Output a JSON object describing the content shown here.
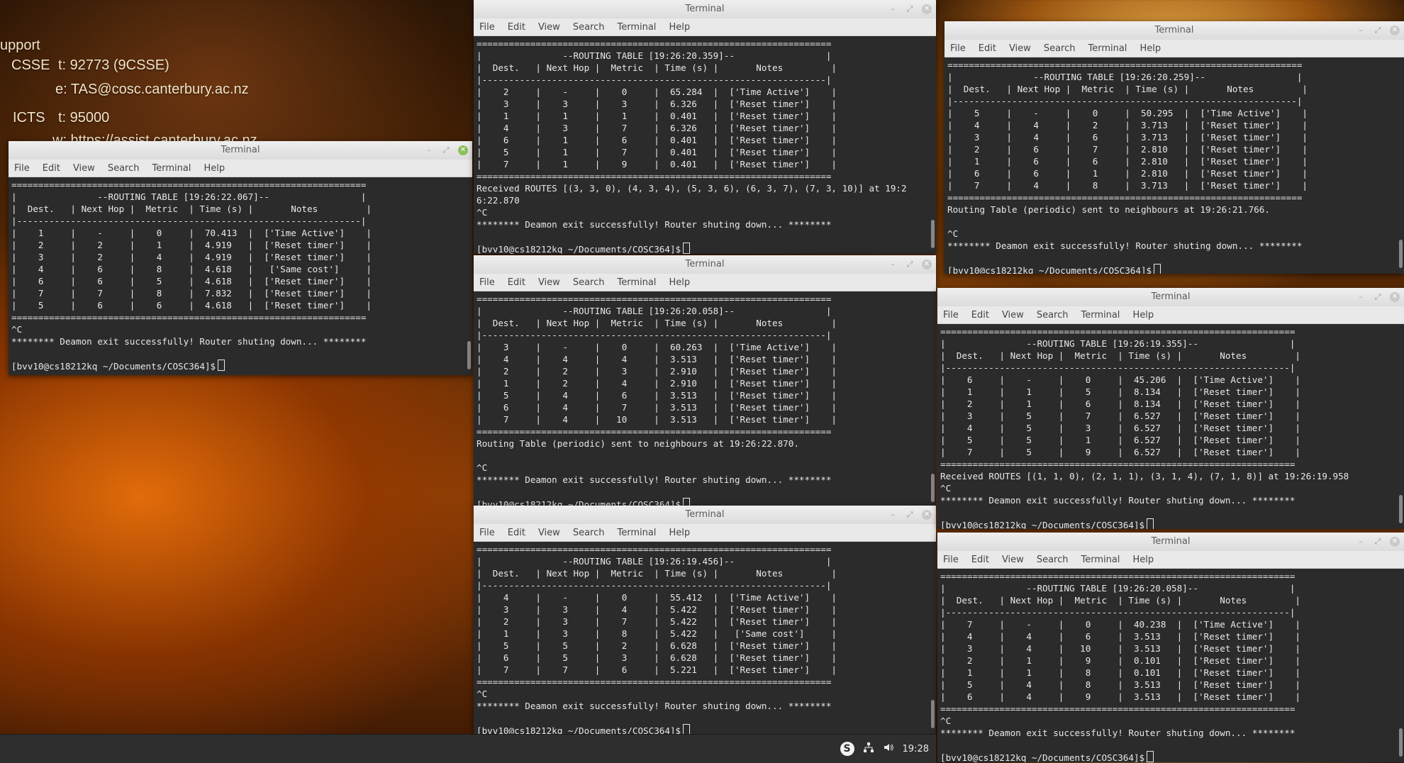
{
  "desktop": {
    "support_lines": [
      "upport",
      "CSSE",
      "t: 92773 (9CSSE)",
      "e: TAS@cosc.canterbury.ac.nz",
      "ICTS",
      "t: 95000",
      "w: https://assist.canterbury.ac.nz"
    ]
  },
  "menu": [
    "File",
    "Edit",
    "View",
    "Search",
    "Terminal",
    "Help"
  ],
  "windows": [
    {
      "title": "Terminal",
      "lines": [
        "==================================================================",
        "|               --ROUTING TABLE [19:26:22.067]--                 |",
        "|  Dest.   | Next Hop |  Metric  | Time (s) |       Notes         |",
        "|----------------------------------------------------------------|",
        "|    1     |    -     |    0     |  70.413  |  ['Time Active']    |",
        "|    2     |    2     |    1     |  4.919   |  ['Reset timer']    |",
        "|    3     |    2     |    4     |  4.919   |  ['Reset timer']    |",
        "|    4     |    6     |    8     |  4.618   |   ['Same cost']     |",
        "|    6     |    6     |    5     |  4.618   |  ['Reset timer']    |",
        "|    7     |    7     |    8     |  7.832   |  ['Reset timer']    |",
        "|    5     |    6     |    6     |  4.618   |  ['Reset timer']    |",
        "==================================================================",
        "^C",
        "******** Deamon exit successfully! Router shuting down... ********",
        "",
        "[bvv10@cs18212kq ~/Documents/COSC364]$"
      ]
    },
    {
      "title": "Terminal",
      "lines": [
        "==================================================================",
        "|               --ROUTING TABLE [19:26:20.359]--                 |",
        "|  Dest.   | Next Hop |  Metric  | Time (s) |       Notes         |",
        "|----------------------------------------------------------------|",
        "|    2     |    -     |    0     |  65.284  |  ['Time Active']    |",
        "|    3     |    3     |    3     |  6.326   |  ['Reset timer']    |",
        "|    1     |    1     |    1     |  0.401   |  ['Reset timer']    |",
        "|    4     |    3     |    7     |  6.326   |  ['Reset timer']    |",
        "|    6     |    1     |    6     |  0.401   |  ['Reset timer']    |",
        "|    5     |    1     |    7     |  0.401   |  ['Reset timer']    |",
        "|    7     |    1     |    9     |  0.401   |  ['Reset timer']    |",
        "==================================================================",
        "Received ROUTES [(3, 3, 0), (4, 3, 4), (5, 3, 6), (6, 3, 7), (7, 3, 10)] at 19:2",
        "6:22.870",
        "^C",
        "******** Deamon exit successfully! Router shuting down... ********",
        "",
        "[bvv10@cs18212kq ~/Documents/COSC364]$"
      ]
    },
    {
      "title": "Terminal",
      "lines": [
        "==================================================================",
        "|               --ROUTING TABLE [19:26:20.058]--                 |",
        "|  Dest.   | Next Hop |  Metric  | Time (s) |       Notes         |",
        "|----------------------------------------------------------------|",
        "|    3     |    -     |    0     |  60.263  |  ['Time Active']    |",
        "|    4     |    4     |    4     |  3.513   |  ['Reset timer']    |",
        "|    2     |    2     |    3     |  2.910   |  ['Reset timer']    |",
        "|    1     |    2     |    4     |  2.910   |  ['Reset timer']    |",
        "|    5     |    4     |    6     |  3.513   |  ['Reset timer']    |",
        "|    6     |    4     |    7     |  3.513   |  ['Reset timer']    |",
        "|    7     |    4     |   10     |  3.513   |  ['Reset timer']    |",
        "==================================================================",
        "Routing Table (periodic) sent to neighbours at 19:26:22.870.",
        "",
        "^C",
        "******** Deamon exit successfully! Router shuting down... ********",
        "",
        "[bvv10@cs18212kq ~/Documents/COSC364]$"
      ]
    },
    {
      "title": "Terminal",
      "lines": [
        "==================================================================",
        "|               --ROUTING TABLE [19:26:19.456]--                 |",
        "|  Dest.   | Next Hop |  Metric  | Time (s) |       Notes         |",
        "|----------------------------------------------------------------|",
        "|    4     |    -     |    0     |  55.412  |  ['Time Active']    |",
        "|    3     |    3     |    4     |  5.422   |  ['Reset timer']    |",
        "|    2     |    3     |    7     |  5.422   |  ['Reset timer']    |",
        "|    1     |    3     |    8     |  5.422   |   ['Same cost']     |",
        "|    5     |    5     |    2     |  6.628   |  ['Reset timer']    |",
        "|    6     |    5     |    3     |  6.628   |  ['Reset timer']    |",
        "|    7     |    7     |    6     |  5.221   |  ['Reset timer']    |",
        "==================================================================",
        "^C",
        "******** Deamon exit successfully! Router shuting down... ********",
        "",
        "[bvv10@cs18212kq ~/Documents/COSC364]$"
      ]
    },
    {
      "title": "Terminal",
      "lines": [
        "==================================================================",
        "|               --ROUTING TABLE [19:26:20.259]--                 |",
        "|  Dest.   | Next Hop |  Metric  | Time (s) |       Notes         |",
        "|----------------------------------------------------------------|",
        "|    5     |    -     |    0     |  50.295  |  ['Time Active']    |",
        "|    4     |    4     |    2     |  3.713   |  ['Reset timer']    |",
        "|    3     |    4     |    6     |  3.713   |  ['Reset timer']    |",
        "|    2     |    6     |    7     |  2.810   |  ['Reset timer']    |",
        "|    1     |    6     |    6     |  2.810   |  ['Reset timer']    |",
        "|    6     |    6     |    1     |  2.810   |  ['Reset timer']    |",
        "|    7     |    4     |    8     |  3.713   |  ['Reset timer']    |",
        "==================================================================",
        "Routing Table (periodic) sent to neighbours at 19:26:21.766.",
        "",
        "^C",
        "******** Deamon exit successfully! Router shuting down... ********",
        "",
        "[bvv10@cs18212kq ~/Documents/COSC364]$"
      ]
    },
    {
      "title": "Terminal",
      "lines": [
        "==================================================================",
        "|               --ROUTING TABLE [19:26:19.355]--                 |",
        "|  Dest.   | Next Hop |  Metric  | Time (s) |       Notes         |",
        "|----------------------------------------------------------------|",
        "|    6     |    -     |    0     |  45.206  |  ['Time Active']    |",
        "|    1     |    1     |    5     |  8.134   |  ['Reset timer']    |",
        "|    2     |    1     |    6     |  8.134   |  ['Reset timer']    |",
        "|    3     |    5     |    7     |  6.527   |  ['Reset timer']    |",
        "|    4     |    5     |    3     |  6.527   |  ['Reset timer']    |",
        "|    5     |    5     |    1     |  6.527   |  ['Reset timer']    |",
        "|    7     |    5     |    9     |  6.527   |  ['Reset timer']    |",
        "==================================================================",
        "Received ROUTES [(1, 1, 0), (2, 1, 1), (3, 1, 4), (7, 1, 8)] at 19:26:19.958",
        "^C",
        "******** Deamon exit successfully! Router shuting down... ********",
        "",
        "[bvv10@cs18212kq ~/Documents/COSC364]$"
      ]
    },
    {
      "title": "Terminal",
      "lines": [
        "==================================================================",
        "|               --ROUTING TABLE [19:26:20.058]--                 |",
        "|  Dest.   | Next Hop |  Metric  | Time (s) |       Notes         |",
        "|----------------------------------------------------------------|",
        "|    7     |    -     |    0     |  40.238  |  ['Time Active']    |",
        "|    4     |    4     |    6     |  3.513   |  ['Reset timer']    |",
        "|    3     |    4     |   10     |  3.513   |  ['Reset timer']    |",
        "|    2     |    1     |    9     |  0.101   |  ['Reset timer']    |",
        "|    1     |    1     |    8     |  0.101   |  ['Reset timer']    |",
        "|    5     |    4     |    8     |  3.513   |  ['Reset timer']    |",
        "|    6     |    4     |    9     |  3.513   |  ['Reset timer']    |",
        "==================================================================",
        "^C",
        "******** Deamon exit successfully! Router shuting down... ********",
        "",
        "[bvv10@cs18212kq ~/Documents/COSC364]$"
      ]
    }
  ],
  "taskbar": {
    "skype_glyph": "S",
    "clock": "19:28"
  }
}
